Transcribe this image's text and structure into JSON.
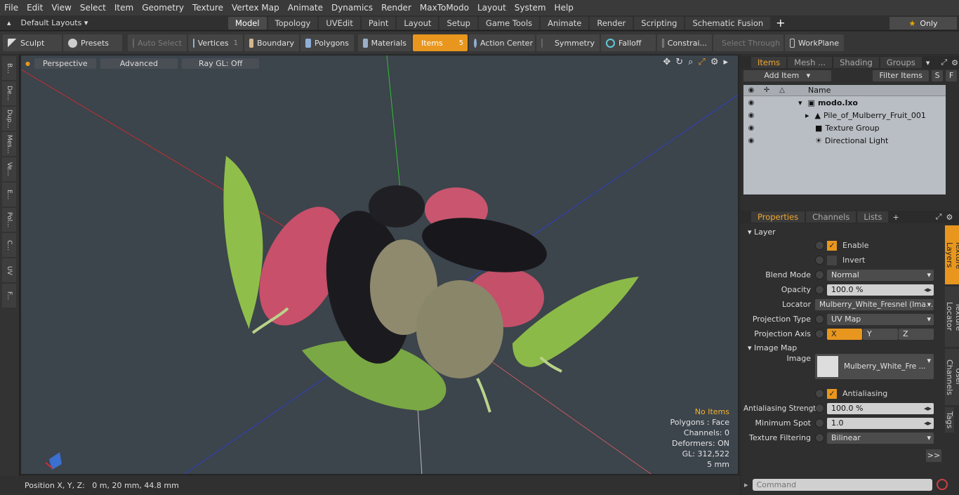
{
  "menu": [
    "File",
    "Edit",
    "View",
    "Select",
    "Item",
    "Geometry",
    "Texture",
    "Vertex Map",
    "Animate",
    "Dynamics",
    "Render",
    "MaxToModo",
    "Layout",
    "System",
    "Help"
  ],
  "layout_selector": "Default Layouts",
  "layout_tabs": [
    "Model",
    "Topology",
    "UVEdit",
    "Paint",
    "Layout",
    "Setup",
    "Game Tools",
    "Animate",
    "Render",
    "Scripting",
    "Schematic Fusion"
  ],
  "only_label": "Only",
  "toolbar": {
    "sculpt": "Sculpt",
    "presets": "Presets",
    "auto_select": "Auto Select",
    "vertices": "Vertices",
    "vertices_count": "1",
    "boundary": "Boundary",
    "polygons": "Polygons",
    "materials": "Materials",
    "items": "Items",
    "items_count": "5",
    "action_center": "Action Center",
    "symmetry": "Symmetry",
    "falloff": "Falloff",
    "constraints": "Constrai...",
    "select_through": "Select Through",
    "workplane": "WorkPlane"
  },
  "left_tabs": [
    "B...",
    "De...",
    "Dup...",
    "Mes...",
    "Ve...",
    "E...",
    "Pol...",
    "C...",
    "UV",
    "F..."
  ],
  "viewport": {
    "perspective": "Perspective",
    "advanced": "Advanced",
    "raygl": "Ray GL: Off",
    "info": {
      "no_items": "No Items",
      "polygons": "Polygons : Face",
      "channels": "Channels: 0",
      "deformers": "Deformers: ON",
      "gl": "GL: 312,522",
      "scale": "5 mm"
    }
  },
  "status": "Position X, Y, Z:   0 m, 20 mm, 44.8 mm",
  "items_panel": {
    "tabs": [
      "Items",
      "Mesh ...",
      "Shading",
      "Groups"
    ],
    "add_item": "Add Item",
    "filter_items": "Filter Items",
    "s_btn": "S",
    "f_btn": "F",
    "name_header": "Name",
    "tree": [
      {
        "label": "modo.lxo"
      },
      {
        "label": "Pile_of_Mulberry_Fruit_001"
      },
      {
        "label": "Texture Group"
      },
      {
        "label": "Directional Light"
      }
    ]
  },
  "properties_panel": {
    "tabs": [
      "Properties",
      "Channels",
      "Lists"
    ],
    "layer_section": "Layer",
    "enable": "Enable",
    "invert": "Invert",
    "blend_mode_label": "Blend Mode",
    "blend_mode": "Normal",
    "opacity_label": "Opacity",
    "opacity": "100.0 %",
    "locator_label": "Locator",
    "locator": "Mulberry_White_Fresnel (Ima...",
    "projection_type_label": "Projection Type",
    "projection_type": "UV Map",
    "projection_axis_label": "Projection Axis",
    "axis_x": "X",
    "axis_y": "Y",
    "axis_z": "Z",
    "image_map_section": "Image Map",
    "image_label": "Image",
    "image": "Mulberry_White_Fre ...",
    "antialiasing": "Antialiasing",
    "aa_strength_label": "Antialiasing Strength",
    "aa_strength": "100.0 %",
    "min_spot_label": "Minimum Spot",
    "min_spot": "1.0",
    "filtering_label": "Texture Filtering",
    "filtering": "Bilinear",
    "more": ">>"
  },
  "right_vtabs": [
    "Texture Layers",
    "Texture Locator",
    "User Channels",
    "Tags"
  ],
  "command_placeholder": "Command",
  "colors": {
    "accent": "#e8961e",
    "viewport_bg": "#3c444c"
  }
}
